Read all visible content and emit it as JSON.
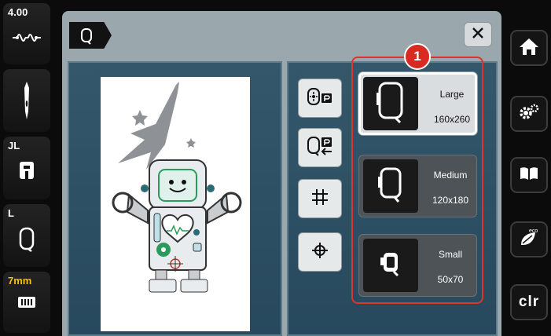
{
  "status": {
    "stitch_width": "4.00",
    "presser_foot_label": "JL",
    "hoop_label": "L",
    "thread_length": "7mm"
  },
  "header": {
    "close_icon": "close-icon"
  },
  "tools": [
    {
      "name": "hoop-center-icon"
    },
    {
      "name": "hoop-change-icon"
    },
    {
      "name": "grid-icon"
    },
    {
      "name": "crosshair-icon"
    }
  ],
  "callout": {
    "number": "1"
  },
  "hoops": [
    {
      "name": "Large",
      "size": "160x260",
      "selected": true
    },
    {
      "name": "Medium",
      "size": "120x180",
      "selected": false
    },
    {
      "name": "Small",
      "size": "50x70",
      "selected": false
    }
  ],
  "nav": {
    "clr_label": "clr"
  },
  "colors": {
    "accent_red": "#d92a22",
    "panel_teal": "#2e5064",
    "dialog_gray": "#9aa7ad",
    "status_yellow": "#f5c400"
  }
}
